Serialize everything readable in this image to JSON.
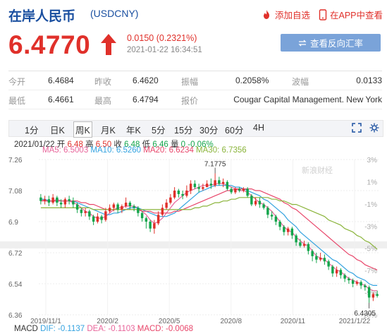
{
  "header": {
    "title": "在岸人民币",
    "code": "(USDCNY)",
    "add_watchlist": "添加自选",
    "open_app": "在APP中查看"
  },
  "price": {
    "last": "6.4770",
    "change": "0.0150 (0.2321%)",
    "time": "2021-01-22 16:34:51",
    "quote_button": "查看反向汇率"
  },
  "stats": {
    "row1": [
      {
        "label": "今开",
        "value": "6.4684"
      },
      {
        "label": "昨收",
        "value": "6.4620"
      },
      {
        "label": "振幅",
        "value": "0.2058%"
      },
      {
        "label": "波幅",
        "value": "0.0133"
      }
    ],
    "row2": [
      {
        "label": "最低",
        "value": "6.4661"
      },
      {
        "label": "最高",
        "value": "6.4794"
      },
      {
        "label": "报价",
        "value": "Cougar Capital Management. New York"
      }
    ]
  },
  "tabs": [
    "1分",
    "日K",
    "周K",
    "月K",
    "年K",
    "5分",
    "15分",
    "30分",
    "60分",
    "4H"
  ],
  "active_tab": "周K",
  "ohlc": {
    "date": "2021/01/22",
    "open_label": "开",
    "open": "6.48",
    "high_label": "高",
    "high": "6.50",
    "close_label": "收",
    "close": "6.48",
    "low_label": "低",
    "low": "6.46",
    "chg_label": "量",
    "chg": "0 -0.06%"
  },
  "ma": [
    {
      "label": "MA5: 6.5003",
      "color": "#e8649a"
    },
    {
      "label": "MA10: 6.5260",
      "color": "#34a3e0"
    },
    {
      "label": "MA20: 6.6234",
      "color": "#e8466a"
    },
    {
      "label": "MA30: 6.7356",
      "color": "#8ab43a"
    }
  ],
  "macd": {
    "label": "MACD",
    "dif": "DIF: -0.1137",
    "dea": "DEA: -0.1103",
    "macd": "MACD: -0.0068"
  },
  "chart_data": {
    "type": "candlestick",
    "watermark": "新浪财经",
    "y_ticks": [
      "7.26",
      "7.08",
      "6.9",
      "6.72",
      "6.54",
      "6.36"
    ],
    "y_pct_ticks": [
      "3%",
      "1%",
      "-1%",
      "-3%",
      "-5%",
      "-7%",
      "-9%",
      "-10%"
    ],
    "x_ticks": [
      "2019/11/1",
      "2020/2",
      "2020/5",
      "2020/8",
      "2020/11",
      "2021/1/22"
    ],
    "ylim": [
      6.36,
      7.26
    ],
    "annotations": {
      "max": "7.1775",
      "min": "6.4305"
    },
    "candles": [
      [
        7.04,
        7.02,
        7.06,
        7.0
      ],
      [
        7.02,
        7.03,
        7.05,
        7.0
      ],
      [
        7.03,
        7.01,
        7.05,
        6.99
      ],
      [
        7.01,
        7.04,
        7.06,
        7.0
      ],
      [
        7.04,
        7.01,
        7.05,
        6.99
      ],
      [
        7.01,
        7.0,
        7.03,
        6.98
      ],
      [
        7.0,
        7.03,
        7.04,
        6.98
      ],
      [
        7.03,
        7.02,
        7.05,
        7.0
      ],
      [
        7.02,
        7.0,
        7.04,
        6.98
      ],
      [
        7.0,
        6.97,
        7.01,
        6.95
      ],
      [
        6.97,
        6.95,
        6.98,
        6.93
      ],
      [
        6.95,
        6.96,
        6.98,
        6.93
      ],
      [
        6.96,
        6.93,
        6.97,
        6.91
      ],
      [
        6.93,
        6.9,
        6.94,
        6.88
      ],
      [
        6.9,
        6.93,
        6.95,
        6.89
      ],
      [
        6.93,
        6.91,
        6.94,
        6.89
      ],
      [
        6.91,
        6.96,
        6.98,
        6.9
      ],
      [
        6.96,
        6.98,
        7.0,
        6.95
      ],
      [
        6.98,
        7.0,
        7.01,
        6.96
      ],
      [
        7.0,
        6.97,
        7.01,
        6.95
      ],
      [
        6.97,
        6.99,
        7.0,
        6.95
      ],
      [
        6.99,
        7.01,
        7.04,
        6.98
      ],
      [
        7.01,
        6.99,
        7.02,
        6.97
      ],
      [
        6.99,
        6.98,
        7.0,
        6.96
      ],
      [
        6.98,
        6.95,
        6.99,
        6.93
      ],
      [
        6.95,
        6.92,
        6.96,
        6.9
      ],
      [
        6.92,
        6.9,
        6.93,
        6.86
      ],
      [
        6.9,
        6.86,
        6.91,
        6.84
      ],
      [
        6.86,
        6.89,
        6.91,
        6.83
      ],
      [
        6.89,
        6.94,
        6.96,
        6.88
      ],
      [
        6.94,
        6.98,
        7.0,
        6.93
      ],
      [
        6.98,
        7.01,
        7.03,
        6.97
      ],
      [
        7.01,
        7.04,
        7.06,
        7.0
      ],
      [
        7.04,
        7.08,
        7.1,
        7.03
      ],
      [
        7.08,
        7.06,
        7.09,
        7.04
      ],
      [
        7.06,
        7.05,
        7.08,
        7.03
      ],
      [
        7.05,
        7.08,
        7.11,
        7.04
      ],
      [
        7.08,
        7.12,
        7.14,
        7.06
      ],
      [
        7.12,
        7.1,
        7.14,
        7.09
      ],
      [
        7.1,
        7.09,
        7.12,
        7.07
      ],
      [
        7.09,
        7.1,
        7.12,
        7.08
      ],
      [
        7.1,
        7.12,
        7.14,
        7.1
      ],
      [
        7.12,
        7.11,
        7.15,
        7.09
      ],
      [
        7.11,
        7.14,
        7.18,
        7.1
      ],
      [
        7.14,
        7.12,
        7.16,
        7.11
      ],
      [
        7.12,
        7.13,
        7.15,
        7.1
      ],
      [
        7.13,
        7.09,
        7.14,
        7.08
      ],
      [
        7.09,
        7.07,
        7.1,
        7.06
      ],
      [
        7.07,
        7.09,
        7.1,
        7.06
      ],
      [
        7.09,
        7.08,
        7.1,
        7.07
      ],
      [
        7.08,
        7.09,
        7.1,
        7.07
      ],
      [
        7.09,
        7.05,
        7.1,
        7.04
      ],
      [
        7.05,
        7.0,
        7.06,
        6.99
      ],
      [
        7.0,
        7.02,
        7.04,
        6.99
      ],
      [
        7.02,
        7.0,
        7.04,
        6.98
      ],
      [
        7.0,
        6.98,
        7.01,
        6.97
      ],
      [
        6.98,
        6.94,
        6.99,
        6.92
      ],
      [
        6.94,
        6.93,
        6.96,
        6.91
      ],
      [
        6.93,
        6.9,
        6.94,
        6.88
      ],
      [
        6.9,
        6.87,
        6.91,
        6.85
      ],
      [
        6.87,
        6.84,
        6.88,
        6.82
      ],
      [
        6.84,
        6.86,
        6.87,
        6.82
      ],
      [
        6.86,
        6.82,
        6.87,
        6.8
      ],
      [
        6.82,
        6.78,
        6.83,
        6.76
      ],
      [
        6.78,
        6.76,
        6.8,
        6.75
      ],
      [
        6.76,
        6.77,
        6.79,
        6.75
      ],
      [
        6.77,
        6.73,
        6.78,
        6.71
      ],
      [
        6.73,
        6.7,
        6.74,
        6.67
      ],
      [
        6.7,
        6.68,
        6.72,
        6.66
      ],
      [
        6.68,
        6.69,
        6.72,
        6.67
      ],
      [
        6.69,
        6.67,
        6.71,
        6.65
      ],
      [
        6.67,
        6.64,
        6.68,
        6.62
      ],
      [
        6.64,
        6.6,
        6.65,
        6.58
      ],
      [
        6.6,
        6.62,
        6.64,
        6.58
      ],
      [
        6.62,
        6.59,
        6.63,
        6.57
      ],
      [
        6.59,
        6.57,
        6.6,
        6.55
      ],
      [
        6.57,
        6.56,
        6.58,
        6.54
      ],
      [
        6.56,
        6.54,
        6.57,
        6.52
      ],
      [
        6.54,
        6.55,
        6.56,
        6.53
      ],
      [
        6.55,
        6.53,
        6.56,
        6.51
      ],
      [
        6.53,
        6.52,
        6.54,
        6.5
      ],
      [
        6.52,
        6.46,
        6.53,
        6.43
      ],
      [
        6.46,
        6.48,
        6.49,
        6.44
      ],
      [
        6.48,
        6.47,
        6.5,
        6.46
      ]
    ],
    "ma_lines": [
      {
        "name": "MA5",
        "color": "#e8649a",
        "values": [
          7.03,
          7.02,
          7.02,
          7.02,
          7.03,
          7.02,
          7.02,
          7.02,
          7.01,
          7.0,
          6.98,
          6.96,
          6.95,
          6.93,
          6.92,
          6.92,
          6.93,
          6.95,
          6.97,
          6.98,
          6.98,
          6.99,
          6.99,
          6.99,
          6.98,
          6.96,
          6.94,
          6.91,
          6.89,
          6.9,
          6.92,
          6.95,
          6.98,
          7.01,
          7.03,
          7.05,
          7.07,
          7.08,
          7.09,
          7.1,
          7.11,
          7.11,
          7.11,
          7.12,
          7.12,
          7.12,
          7.11,
          7.1,
          7.09,
          7.08,
          7.08,
          7.07,
          7.05,
          7.03,
          7.01,
          7.0,
          6.98,
          6.96,
          6.93,
          6.9,
          6.87,
          6.85,
          6.84,
          6.81,
          6.79,
          6.77,
          6.76,
          6.73,
          6.7,
          6.69,
          6.68,
          6.66,
          6.64,
          6.62,
          6.61,
          6.59,
          6.57,
          6.56,
          6.55,
          6.54,
          6.53,
          6.51,
          6.5,
          6.5
        ]
      },
      {
        "name": "MA10",
        "color": "#34a3e0",
        "values": [
          7.03,
          7.03,
          7.02,
          7.02,
          7.02,
          7.02,
          7.02,
          7.02,
          7.02,
          7.01,
          7.0,
          6.99,
          6.98,
          6.97,
          6.96,
          6.95,
          6.94,
          6.94,
          6.95,
          6.95,
          6.96,
          6.97,
          6.98,
          6.98,
          6.98,
          6.97,
          6.96,
          6.95,
          6.94,
          6.93,
          6.93,
          6.93,
          6.94,
          6.95,
          6.97,
          6.99,
          7.01,
          7.03,
          7.05,
          7.07,
          7.08,
          7.09,
          7.1,
          7.11,
          7.11,
          7.11,
          7.11,
          7.11,
          7.1,
          7.1,
          7.09,
          7.08,
          7.07,
          7.06,
          7.05,
          7.03,
          7.02,
          7.0,
          6.98,
          6.96,
          6.94,
          6.91,
          6.89,
          6.87,
          6.84,
          6.82,
          6.8,
          6.78,
          6.76,
          6.74,
          6.72,
          6.7,
          6.68,
          6.67,
          6.65,
          6.63,
          6.61,
          6.6,
          6.58,
          6.57,
          6.56,
          6.54,
          6.53,
          6.53
        ]
      },
      {
        "name": "MA20",
        "color": "#e8466a",
        "values": [
          7.02,
          7.02,
          7.02,
          7.02,
          7.02,
          7.02,
          7.02,
          7.02,
          7.02,
          7.02,
          7.01,
          7.01,
          7.0,
          7.0,
          6.99,
          6.98,
          6.97,
          6.97,
          6.97,
          6.97,
          6.97,
          6.97,
          6.97,
          6.97,
          6.97,
          6.96,
          6.96,
          6.96,
          6.95,
          6.95,
          6.95,
          6.95,
          6.95,
          6.96,
          6.96,
          6.97,
          6.98,
          6.99,
          7.0,
          7.01,
          7.02,
          7.03,
          7.04,
          7.05,
          7.06,
          7.07,
          7.08,
          7.08,
          7.09,
          7.09,
          7.09,
          7.09,
          7.09,
          7.08,
          7.08,
          7.07,
          7.06,
          7.05,
          7.04,
          7.03,
          7.01,
          7.0,
          6.98,
          6.97,
          6.95,
          6.93,
          6.91,
          6.89,
          6.87,
          6.85,
          6.83,
          6.81,
          6.79,
          6.77,
          6.75,
          6.73,
          6.71,
          6.7,
          6.68,
          6.67,
          6.65,
          6.64,
          6.63,
          6.62
        ]
      },
      {
        "name": "MA30",
        "color": "#8ab43a",
        "values": [
          6.98,
          6.98,
          6.98,
          6.98,
          6.98,
          6.98,
          6.98,
          6.98,
          6.98,
          6.98,
          6.98,
          6.98,
          6.98,
          6.97,
          6.97,
          6.97,
          6.97,
          6.97,
          6.97,
          6.97,
          6.97,
          6.97,
          6.97,
          6.97,
          6.97,
          6.97,
          6.97,
          6.97,
          6.97,
          6.97,
          6.97,
          6.97,
          6.97,
          6.97,
          6.97,
          6.97,
          6.97,
          6.97,
          6.98,
          6.98,
          6.99,
          6.99,
          7.0,
          7.01,
          7.01,
          7.02,
          7.02,
          7.03,
          7.03,
          7.04,
          7.04,
          7.04,
          7.04,
          7.04,
          7.04,
          7.04,
          7.04,
          7.03,
          7.03,
          7.02,
          7.02,
          7.01,
          7.0,
          7.0,
          6.99,
          6.98,
          6.97,
          6.96,
          6.95,
          6.94,
          6.93,
          6.91,
          6.9,
          6.89,
          6.88,
          6.86,
          6.85,
          6.84,
          6.82,
          6.81,
          6.79,
          6.78,
          6.76,
          6.74
        ]
      }
    ]
  }
}
